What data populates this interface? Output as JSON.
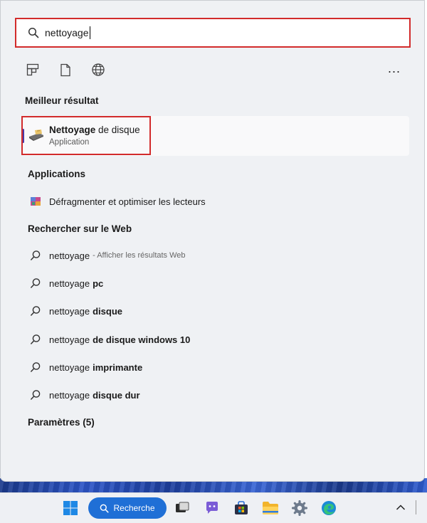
{
  "search": {
    "value": "nettoyage"
  },
  "filters": {
    "icons": [
      "apps-icon",
      "document-icon",
      "web-icon"
    ],
    "more": "..."
  },
  "best_match": {
    "heading": "Meilleur résultat",
    "title_bold": "Nettoyage",
    "title_rest": "de disque",
    "subtitle": "Application"
  },
  "apps": {
    "heading": "Applications",
    "items": [
      {
        "label": "Défragmenter et optimiser les lecteurs"
      }
    ]
  },
  "web": {
    "heading": "Rechercher sur le Web",
    "items": [
      {
        "prefix": "nettoyage",
        "suffix": "",
        "hint": "- Afficher les résultats Web"
      },
      {
        "prefix": "nettoyage",
        "suffix": "pc",
        "hint": ""
      },
      {
        "prefix": "nettoyage",
        "suffix": "disque",
        "hint": ""
      },
      {
        "prefix": "nettoyage",
        "suffix": "de disque windows 10",
        "hint": ""
      },
      {
        "prefix": "nettoyage",
        "suffix": "imprimante",
        "hint": ""
      },
      {
        "prefix": "nettoyage",
        "suffix": "disque dur",
        "hint": ""
      }
    ]
  },
  "settings": {
    "heading": "Paramètres (5)"
  },
  "taskbar": {
    "search_label": "Recherche",
    "icons": [
      "windows-start-icon",
      "search-icon",
      "task-view-icon",
      "chat-icon",
      "store-icon",
      "file-explorer-icon",
      "settings-gear-icon",
      "edge-browser-icon",
      "chevron-up-icon"
    ]
  },
  "colors": {
    "highlight": "#d22b2b",
    "accent": "#4a3aa8",
    "taskbar_search": "#1f6fd6"
  }
}
